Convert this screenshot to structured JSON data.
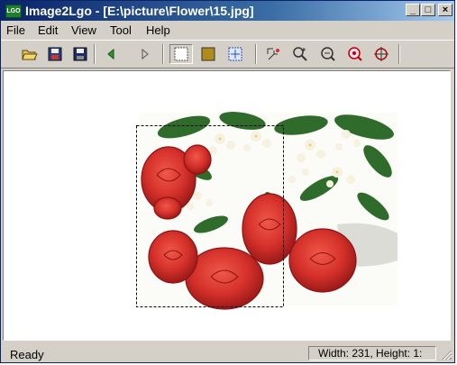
{
  "window": {
    "app_icon_text": "LGO",
    "title": "Image2Lgo - [E:\\picture\\Flower\\15.jpg]",
    "minimize_glyph": "_",
    "maximize_glyph": "□",
    "close_glyph": "×"
  },
  "menu": [
    "File",
    "Edit",
    "View",
    "Tool",
    "Help"
  ],
  "toolbar": {
    "buttons": [
      {
        "name": "open-icon",
        "pressed": false
      },
      {
        "name": "save-logo-icon",
        "pressed": false
      },
      {
        "name": "save-icon",
        "pressed": false
      },
      {
        "name": "previous-icon",
        "pressed": false
      },
      {
        "name": "next-icon",
        "pressed": false
      },
      {
        "name": "select-rect-icon",
        "pressed": true
      },
      {
        "name": "fill-rect-icon",
        "pressed": false
      },
      {
        "name": "center-select-icon",
        "pressed": false
      },
      {
        "name": "fit-window-icon",
        "pressed": false
      },
      {
        "name": "zoom-in-icon",
        "pressed": false
      },
      {
        "name": "zoom-out-icon",
        "pressed": false
      },
      {
        "name": "zoom-actual-icon",
        "pressed": false
      },
      {
        "name": "crosshair-zoom-icon",
        "pressed": false
      }
    ]
  },
  "status": {
    "ready": "Ready",
    "dimensions": "Width: 231, Height: 1:"
  },
  "colors": {
    "title_start": "#0a246a",
    "title_end": "#a6caf0",
    "chrome": "#d4d0c8",
    "rose": "#d9302a",
    "leaf": "#2f6b2a"
  }
}
